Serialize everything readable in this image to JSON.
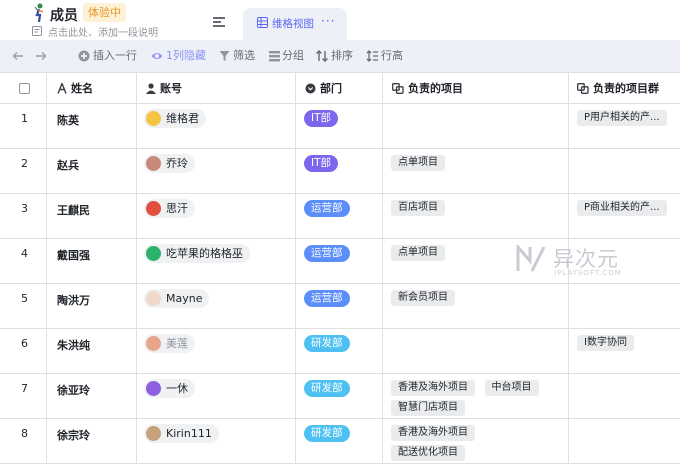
{
  "app": {
    "title": "成员",
    "trial_badge": "体验中",
    "description_placeholder": "点击此处、添加一段说明"
  },
  "view_tab": {
    "label": "维格视图",
    "more": "···"
  },
  "toolbar": {
    "undo_icon": "undo-icon",
    "redo_icon": "redo-icon",
    "insert_row": "插入一行",
    "hidden_columns": "1列隐藏",
    "filter": "筛选",
    "group": "分组",
    "sort": "排序",
    "row_height": "行高"
  },
  "columns": [
    "姓名",
    "账号",
    "部门",
    "负责的项目",
    "负责的项目群"
  ],
  "dept_colors": {
    "IT部": "#7b67ee",
    "运营部": "#5c8ef9",
    "研发部": "#4ec0f2"
  },
  "rows": [
    {
      "num": "1",
      "name": "陈英",
      "account": "维格君",
      "dept": "IT部",
      "projects": [],
      "groups": [
        "P用户相关的产..."
      ]
    },
    {
      "num": "2",
      "name": "赵兵",
      "account": "乔玲",
      "dept": "IT部",
      "projects": [
        "点单项目"
      ],
      "groups": []
    },
    {
      "num": "3",
      "name": "王麒民",
      "account": "思汗",
      "dept": "运营部",
      "projects": [
        "百店项目"
      ],
      "groups": [
        "P商业相关的产..."
      ]
    },
    {
      "num": "4",
      "name": "戴国强",
      "account": "吃苹果的格格巫",
      "dept": "运营部",
      "projects": [
        "点单项目"
      ],
      "groups": []
    },
    {
      "num": "5",
      "name": "陶洪万",
      "account": "Mayne",
      "dept": "运营部",
      "projects": [
        "新会员项目"
      ],
      "groups": []
    },
    {
      "num": "6",
      "name": "朱洪纯",
      "account": "美莲",
      "dept": "研发部",
      "projects": [],
      "groups": [
        "I数字协同"
      ]
    },
    {
      "num": "7",
      "name": "徐亚玲",
      "account": "一休",
      "dept": "研发部",
      "projects": [
        "香港及海外项目",
        "中台项目",
        "智慧门店项目"
      ],
      "groups": []
    },
    {
      "num": "8",
      "name": "徐宗玲",
      "account": "Kirin111",
      "dept": "研发部",
      "projects": [
        "香港及海外项目",
        "配送优化项目"
      ],
      "groups": []
    }
  ],
  "watermark": {
    "title": "异次元",
    "subtitle": "IPLAYSOFT.COM"
  }
}
